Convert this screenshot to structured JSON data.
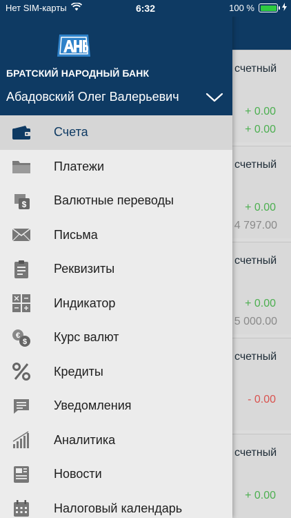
{
  "status_bar": {
    "carrier": "Нет SIM-карты",
    "time": "6:32",
    "battery": "100 %"
  },
  "drawer": {
    "bank_name": "БРАТСКИЙ НАРОДНЫЙ БАНК",
    "user_name": "Абадовский Олег Валерьевич",
    "menu": [
      {
        "label": "Счета",
        "icon": "wallet-icon",
        "active": true
      },
      {
        "label": "Платежи",
        "icon": "folder-icon"
      },
      {
        "label": "Валютные переводы",
        "icon": "currency-transfer-icon"
      },
      {
        "label": "Письма",
        "icon": "envelope-icon"
      },
      {
        "label": "Реквизиты",
        "icon": "clipboard-icon"
      },
      {
        "label": "Индикатор",
        "icon": "calculator-icon"
      },
      {
        "label": "Курс валют",
        "icon": "exchange-rate-icon"
      },
      {
        "label": "Кредиты",
        "icon": "percent-icon"
      },
      {
        "label": "Уведомления",
        "icon": "message-icon"
      },
      {
        "label": "Аналитика",
        "icon": "bar-chart-icon"
      },
      {
        "label": "Новости",
        "icon": "newspaper-icon"
      },
      {
        "label": "Налоговый календарь",
        "icon": "calendar-icon"
      }
    ]
  },
  "accounts": [
    {
      "title": "счетный",
      "values": [
        "+ 0.00",
        "+ 0.00"
      ]
    },
    {
      "title": "счетный",
      "values": [
        "+ 0.00",
        "4 797.00"
      ]
    },
    {
      "title": "счетный",
      "values": [
        "+ 0.00",
        "5 000.00"
      ]
    },
    {
      "title": "счетный",
      "values": [
        "- 0.00"
      ]
    },
    {
      "title": "счетный",
      "values": [
        "+ 0.00"
      ]
    }
  ],
  "colors": {
    "brand": "#0e3a63",
    "positive": "#4caf50",
    "negative": "#d9534f"
  }
}
